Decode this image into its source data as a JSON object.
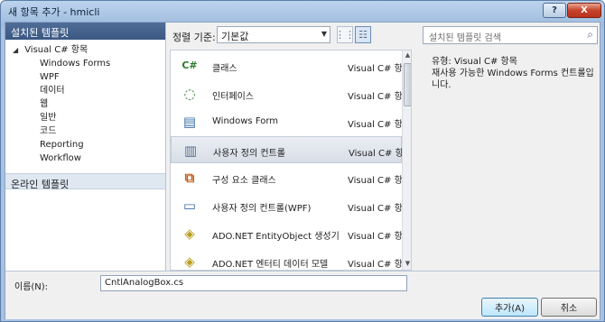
{
  "window": {
    "title": "새 항목 추가 - hmicli",
    "help_label": "?",
    "close_label": "X"
  },
  "left": {
    "installed_header": "설치된 템플릿",
    "root_item": "Visual C# 항목",
    "children": [
      "Windows Forms",
      "WPF",
      "데이터",
      "웹",
      "일반",
      "코드",
      "Reporting",
      "Workflow"
    ],
    "online_header": "온라인 템플릿"
  },
  "toolbar": {
    "sort_label": "정렬 기준:",
    "sort_value": "기본값",
    "search_placeholder": "설치된 템플릿 검색"
  },
  "templates": [
    {
      "name": "클래스",
      "type": "Visual C# 항목",
      "icon": "class-icon",
      "selected": false
    },
    {
      "name": "인터페이스",
      "type": "Visual C# 항목",
      "icon": "interface-icon",
      "selected": false
    },
    {
      "name": "Windows Form",
      "type": "Visual C# 항목",
      "icon": "windows-form-icon",
      "selected": false
    },
    {
      "name": "사용자 정의 컨트롤",
      "type": "Visual C# 항목",
      "icon": "user-control-icon",
      "selected": true
    },
    {
      "name": "구성 요소 클래스",
      "type": "Visual C# 항목",
      "icon": "component-class-icon",
      "selected": false
    },
    {
      "name": "사용자 정의 컨트롤(WPF)",
      "type": "Visual C# 항목",
      "icon": "wpf-user-control-icon",
      "selected": false
    },
    {
      "name": "ADO.NET EntityObject 생성기",
      "type": "Visual C# 항목",
      "icon": "entity-object-icon",
      "selected": false
    },
    {
      "name": "ADO.NET 엔터티 데이터 모델",
      "type": "Visual C# 항목",
      "icon": "entity-data-model-icon",
      "selected": false
    }
  ],
  "details": {
    "type_line": "유형: Visual C# 항목",
    "description": "재사용 가능한 Windows Forms 컨트롤입니다."
  },
  "bottom": {
    "name_label": "이름(N):",
    "name_value": "CntlAnalogBox.cs",
    "ok_label": "추가(A)",
    "cancel_label": "취소"
  },
  "colors": {
    "title_gradient": "#9fbbdf",
    "header_blue": "#3b5884",
    "close_red": "#c7432b"
  }
}
